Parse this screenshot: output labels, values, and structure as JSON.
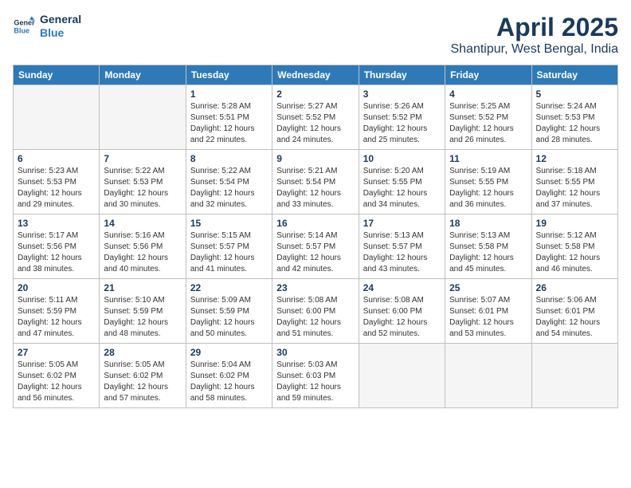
{
  "logo": {
    "line1": "General",
    "line2": "Blue"
  },
  "title": "April 2025",
  "subtitle": "Shantipur, West Bengal, India",
  "days_header": [
    "Sunday",
    "Monday",
    "Tuesday",
    "Wednesday",
    "Thursday",
    "Friday",
    "Saturday"
  ],
  "weeks": [
    [
      {
        "day": "",
        "info": ""
      },
      {
        "day": "",
        "info": ""
      },
      {
        "day": "1",
        "info": "Sunrise: 5:28 AM\nSunset: 5:51 PM\nDaylight: 12 hours and 22 minutes."
      },
      {
        "day": "2",
        "info": "Sunrise: 5:27 AM\nSunset: 5:52 PM\nDaylight: 12 hours and 24 minutes."
      },
      {
        "day": "3",
        "info": "Sunrise: 5:26 AM\nSunset: 5:52 PM\nDaylight: 12 hours and 25 minutes."
      },
      {
        "day": "4",
        "info": "Sunrise: 5:25 AM\nSunset: 5:52 PM\nDaylight: 12 hours and 26 minutes."
      },
      {
        "day": "5",
        "info": "Sunrise: 5:24 AM\nSunset: 5:53 PM\nDaylight: 12 hours and 28 minutes."
      }
    ],
    [
      {
        "day": "6",
        "info": "Sunrise: 5:23 AM\nSunset: 5:53 PM\nDaylight: 12 hours and 29 minutes."
      },
      {
        "day": "7",
        "info": "Sunrise: 5:22 AM\nSunset: 5:53 PM\nDaylight: 12 hours and 30 minutes."
      },
      {
        "day": "8",
        "info": "Sunrise: 5:22 AM\nSunset: 5:54 PM\nDaylight: 12 hours and 32 minutes."
      },
      {
        "day": "9",
        "info": "Sunrise: 5:21 AM\nSunset: 5:54 PM\nDaylight: 12 hours and 33 minutes."
      },
      {
        "day": "10",
        "info": "Sunrise: 5:20 AM\nSunset: 5:55 PM\nDaylight: 12 hours and 34 minutes."
      },
      {
        "day": "11",
        "info": "Sunrise: 5:19 AM\nSunset: 5:55 PM\nDaylight: 12 hours and 36 minutes."
      },
      {
        "day": "12",
        "info": "Sunrise: 5:18 AM\nSunset: 5:55 PM\nDaylight: 12 hours and 37 minutes."
      }
    ],
    [
      {
        "day": "13",
        "info": "Sunrise: 5:17 AM\nSunset: 5:56 PM\nDaylight: 12 hours and 38 minutes."
      },
      {
        "day": "14",
        "info": "Sunrise: 5:16 AM\nSunset: 5:56 PM\nDaylight: 12 hours and 40 minutes."
      },
      {
        "day": "15",
        "info": "Sunrise: 5:15 AM\nSunset: 5:57 PM\nDaylight: 12 hours and 41 minutes."
      },
      {
        "day": "16",
        "info": "Sunrise: 5:14 AM\nSunset: 5:57 PM\nDaylight: 12 hours and 42 minutes."
      },
      {
        "day": "17",
        "info": "Sunrise: 5:13 AM\nSunset: 5:57 PM\nDaylight: 12 hours and 43 minutes."
      },
      {
        "day": "18",
        "info": "Sunrise: 5:13 AM\nSunset: 5:58 PM\nDaylight: 12 hours and 45 minutes."
      },
      {
        "day": "19",
        "info": "Sunrise: 5:12 AM\nSunset: 5:58 PM\nDaylight: 12 hours and 46 minutes."
      }
    ],
    [
      {
        "day": "20",
        "info": "Sunrise: 5:11 AM\nSunset: 5:59 PM\nDaylight: 12 hours and 47 minutes."
      },
      {
        "day": "21",
        "info": "Sunrise: 5:10 AM\nSunset: 5:59 PM\nDaylight: 12 hours and 48 minutes."
      },
      {
        "day": "22",
        "info": "Sunrise: 5:09 AM\nSunset: 5:59 PM\nDaylight: 12 hours and 50 minutes."
      },
      {
        "day": "23",
        "info": "Sunrise: 5:08 AM\nSunset: 6:00 PM\nDaylight: 12 hours and 51 minutes."
      },
      {
        "day": "24",
        "info": "Sunrise: 5:08 AM\nSunset: 6:00 PM\nDaylight: 12 hours and 52 minutes."
      },
      {
        "day": "25",
        "info": "Sunrise: 5:07 AM\nSunset: 6:01 PM\nDaylight: 12 hours and 53 minutes."
      },
      {
        "day": "26",
        "info": "Sunrise: 5:06 AM\nSunset: 6:01 PM\nDaylight: 12 hours and 54 minutes."
      }
    ],
    [
      {
        "day": "27",
        "info": "Sunrise: 5:05 AM\nSunset: 6:02 PM\nDaylight: 12 hours and 56 minutes."
      },
      {
        "day": "28",
        "info": "Sunrise: 5:05 AM\nSunset: 6:02 PM\nDaylight: 12 hours and 57 minutes."
      },
      {
        "day": "29",
        "info": "Sunrise: 5:04 AM\nSunset: 6:02 PM\nDaylight: 12 hours and 58 minutes."
      },
      {
        "day": "30",
        "info": "Sunrise: 5:03 AM\nSunset: 6:03 PM\nDaylight: 12 hours and 59 minutes."
      },
      {
        "day": "",
        "info": ""
      },
      {
        "day": "",
        "info": ""
      },
      {
        "day": "",
        "info": ""
      }
    ]
  ]
}
